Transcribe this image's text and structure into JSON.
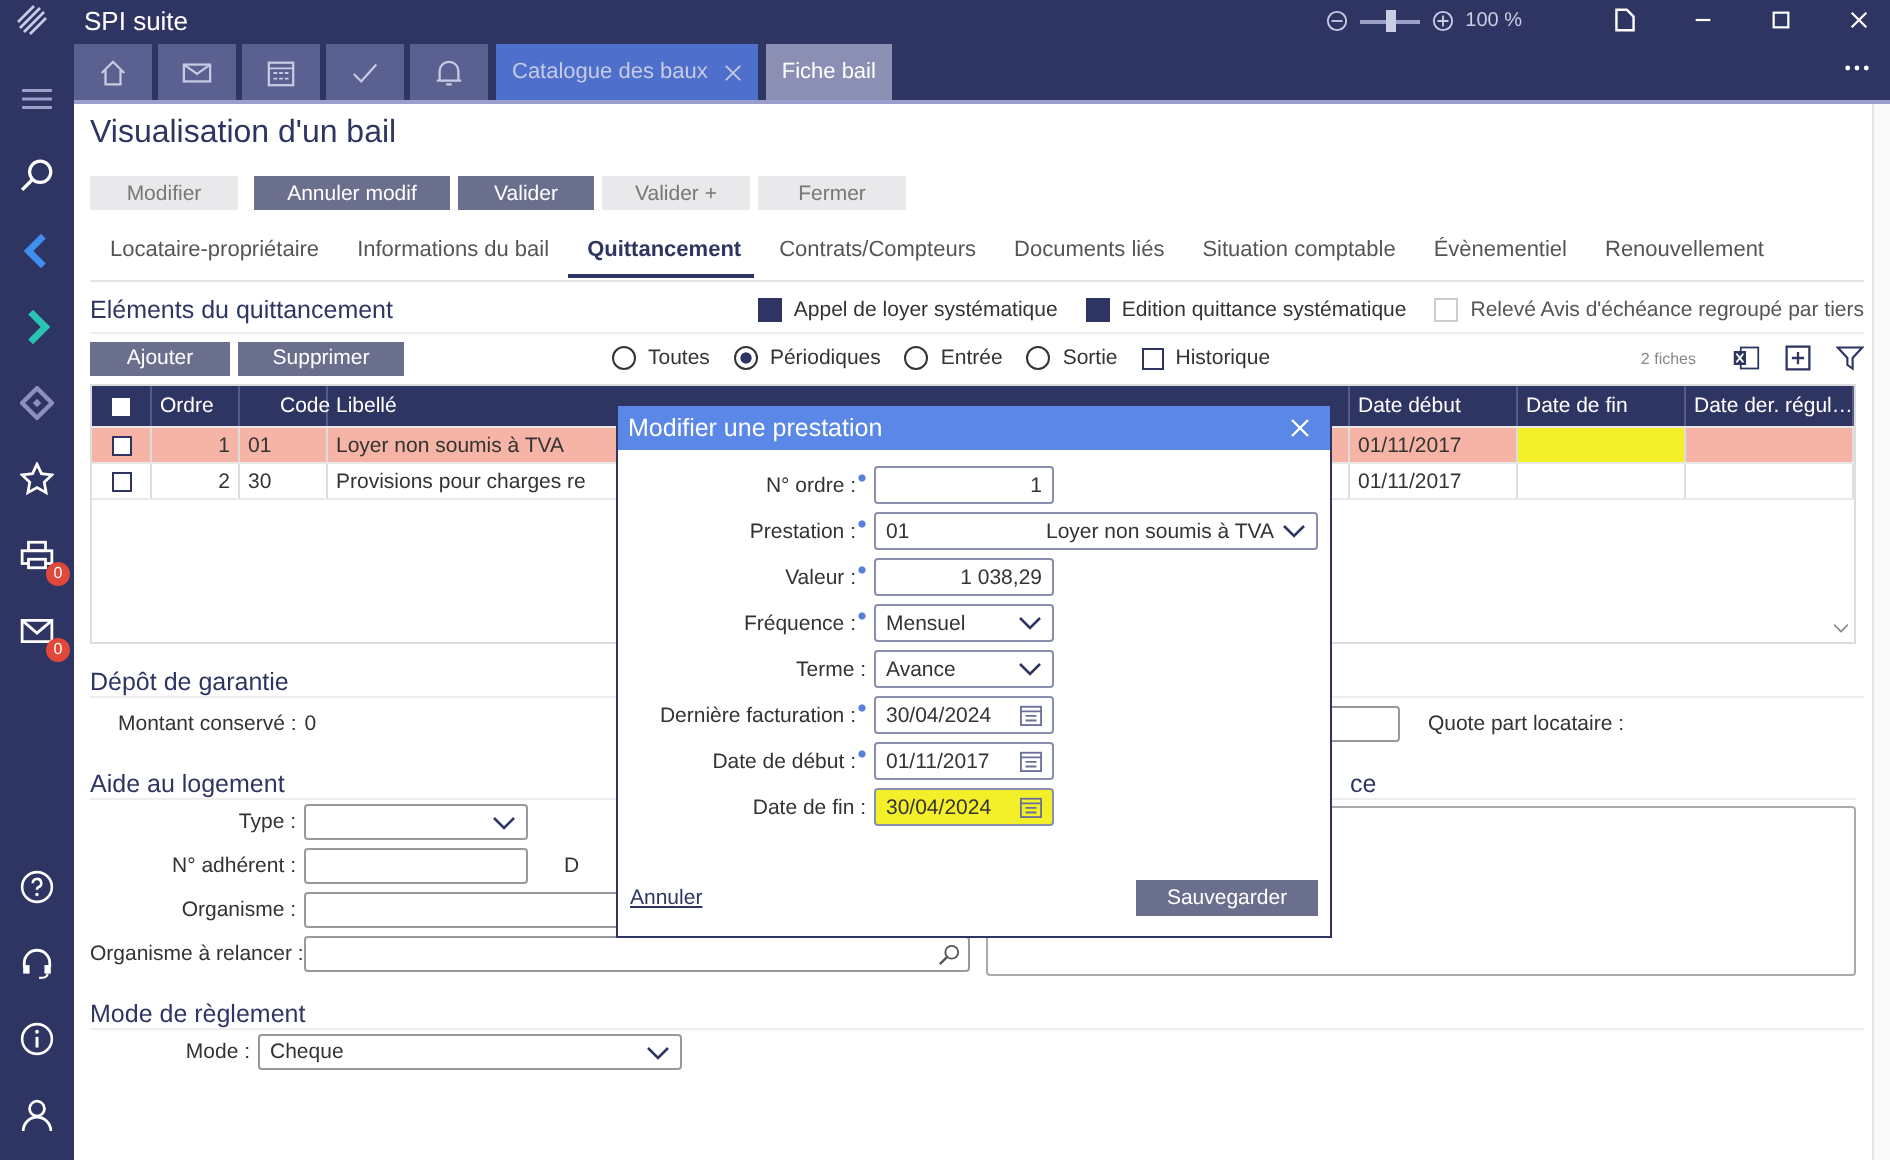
{
  "window": {
    "title": "SPI suite",
    "zoom": {
      "level": 0.5,
      "reading": "100 %"
    }
  },
  "sidebar": {
    "items": [
      {
        "kind": "menu"
      },
      {
        "kind": "search"
      },
      {
        "kind": "nav-back"
      },
      {
        "kind": "nav-forward"
      },
      {
        "kind": "diamond"
      },
      {
        "kind": "star"
      },
      {
        "kind": "printer",
        "badge": "0"
      },
      {
        "kind": "mail",
        "badge": "0"
      }
    ],
    "bottom_items": [
      {
        "kind": "help"
      },
      {
        "kind": "headset"
      },
      {
        "kind": "info"
      },
      {
        "kind": "user"
      }
    ]
  },
  "icon_tabs": [
    {
      "kind": "home"
    },
    {
      "kind": "mail"
    },
    {
      "kind": "calendar"
    },
    {
      "kind": "check"
    },
    {
      "kind": "bell"
    }
  ],
  "tabs": [
    {
      "label": "Catalogue des baux",
      "closable": true,
      "selected": false
    },
    {
      "label": "Fiche bail",
      "closable": false,
      "selected": true
    }
  ],
  "page": {
    "title": "Visualisation d'un bail",
    "actions": [
      {
        "label": "Modifier",
        "disabled": true
      },
      {
        "label": "Annuler modif",
        "disabled": false
      },
      {
        "label": "Valider",
        "disabled": false
      },
      {
        "label": "Valider +",
        "disabled": true
      },
      {
        "label": "Fermer",
        "disabled": true
      }
    ]
  },
  "section_tabs": [
    {
      "label": "Locataire-propriétaire",
      "selected": false
    },
    {
      "label": "Informations du bail",
      "selected": false
    },
    {
      "label": "Quittancement",
      "selected": true
    },
    {
      "label": "Contrats/Compteurs",
      "selected": false
    },
    {
      "label": "Documents liés",
      "selected": false
    },
    {
      "label": "Situation comptable",
      "selected": false
    },
    {
      "label": "Évènementiel",
      "selected": false
    },
    {
      "label": "Renouvellement",
      "selected": false
    }
  ],
  "quittancement": {
    "title": "Eléments du quittancement",
    "options": [
      {
        "label": "Appel de loyer systématique",
        "checked": true,
        "disabled": false
      },
      {
        "label": "Edition quittance systématique",
        "checked": true,
        "disabled": false
      },
      {
        "label": "Relevé Avis d'échéance regroupé par tiers",
        "checked": false,
        "disabled": true
      }
    ],
    "buttons": [
      "Ajouter",
      "Supprimer"
    ],
    "filters": [
      {
        "label": "Toutes",
        "selected": false
      },
      {
        "label": "Périodiques",
        "selected": true
      },
      {
        "label": "Entrée",
        "selected": false
      },
      {
        "label": "Sortie",
        "selected": false
      }
    ],
    "historique": {
      "label": "Historique",
      "checked": false
    },
    "count": "2 fiches",
    "table": {
      "all_checked": false,
      "columns": [
        {
          "label": "Ordre",
          "sorted": false
        },
        {
          "label": "Code",
          "sorted": true
        },
        {
          "label": "Libellé",
          "sorted": false
        },
        {
          "label": "Date début",
          "sorted": false
        },
        {
          "label": "Date de fin",
          "sorted": false
        },
        {
          "label": "Date der. régul…",
          "sorted": false
        }
      ],
      "rows": [
        {
          "checked": false,
          "selected": true,
          "ordre": "1",
          "code": "01",
          "libelle": "Loyer non soumis à TVA",
          "date_debut": "01/11/2017",
          "date_fin_marked": true
        },
        {
          "checked": false,
          "selected": false,
          "ordre": "2",
          "code": "30",
          "libelle": "Provisions pour charges re",
          "date_debut": "01/11/2017",
          "date_fin_marked": false
        }
      ]
    }
  },
  "depot": {
    "title": "Dépôt de garantie",
    "montant_label": "Montant conservé :",
    "montant_value": "0",
    "quote_label": "Quote part locataire :"
  },
  "aide": {
    "title": "Aide au logement",
    "fields": [
      {
        "label": "Type :",
        "kind": "select"
      },
      {
        "label": "N° adhérent :",
        "kind": "text",
        "side_label": "D"
      },
      {
        "label": "Organisme :",
        "kind": "wide"
      },
      {
        "label": "Organisme à relancer :",
        "kind": "search"
      }
    ],
    "side_title": "ce"
  },
  "reglement": {
    "title": "Mode de règlement",
    "mode_label": "Mode :",
    "mode_value": "Cheque"
  },
  "dialog": {
    "title": "Modifier une prestation",
    "fields": [
      {
        "label": "N° ordre :",
        "required": true,
        "kind": "number",
        "value": "1"
      },
      {
        "label": "Prestation :",
        "required": true,
        "kind": "select",
        "code": "01",
        "value": "Loyer non soumis à TVA"
      },
      {
        "label": "Valeur :",
        "required": true,
        "kind": "number",
        "value": "1 038,29"
      },
      {
        "label": "Fréquence :",
        "required": true,
        "kind": "select",
        "value": "Mensuel"
      },
      {
        "label": "Terme :",
        "required": false,
        "kind": "select",
        "value": "Avance"
      },
      {
        "label": "Dernière facturation :",
        "required": true,
        "kind": "date",
        "value": "30/04/2024",
        "marked": false
      },
      {
        "label": "Date de début :",
        "required": true,
        "kind": "date",
        "value": "01/11/2017",
        "marked": false
      },
      {
        "label": "Date de fin :",
        "required": false,
        "kind": "date",
        "value": "30/04/2024",
        "marked": true
      }
    ],
    "cancel": "Annuler",
    "save": "Sauvegarder"
  }
}
